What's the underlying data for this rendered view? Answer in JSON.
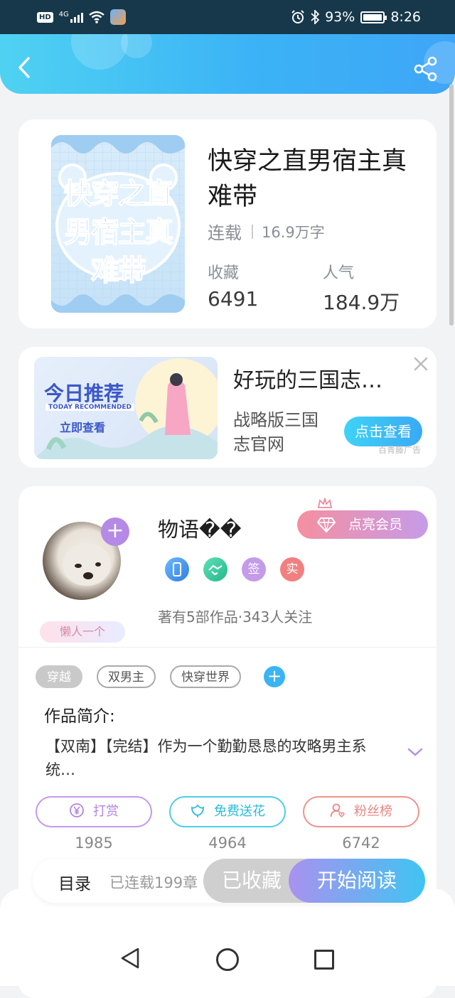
{
  "status_bar": {
    "hd": "HD",
    "network": "4G",
    "battery": "93%",
    "time": "8:26"
  },
  "header": {
    "back_icon": "back-arrow-icon",
    "share_icon": "share-icon"
  },
  "book": {
    "cover_text": "快穿之直男宿主真难带",
    "title": "快穿之直男宿主真难带",
    "status": "连载",
    "word_count": "16.9万字",
    "favorites_label": "收藏",
    "favorites_value": "6491",
    "popularity_label": "人气",
    "popularity_value": "184.9万"
  },
  "ad": {
    "banner_title": "今日推荐",
    "banner_sub": "TODAY RECOMMENDED",
    "banner_btn": "立即查看",
    "title": "好玩的三国志…",
    "desc": "战略版三国志官网",
    "button": "点击查看",
    "source": "百青藤广告"
  },
  "author": {
    "name": "物语��",
    "vip_button": "点亮会员",
    "badges": [
      "签",
      "实"
    ],
    "stats": "著有5部作品·343人关注",
    "lazy_badge": "懒人一个"
  },
  "tags": [
    "穿越",
    "双男主",
    "快穿世界"
  ],
  "intro": {
    "heading": "作品简介:",
    "text": "【双南】【完结】作为一个勤勤恳恳的攻略男主系统…"
  },
  "actions": [
    {
      "label": "打赏",
      "count": "1985"
    },
    {
      "label": "免费送花",
      "count": "4964"
    },
    {
      "label": "粉丝榜",
      "count": "6742"
    }
  ],
  "bottom_bar": {
    "toc": "目录",
    "serial": "已连载199章",
    "collected": "已收藏",
    "start": "开始阅读"
  },
  "colors": {
    "header_start": "#4fd2f2",
    "header_end": "#3ea6f7",
    "vip": "#f58fa0",
    "purple": "#b48ae6"
  }
}
